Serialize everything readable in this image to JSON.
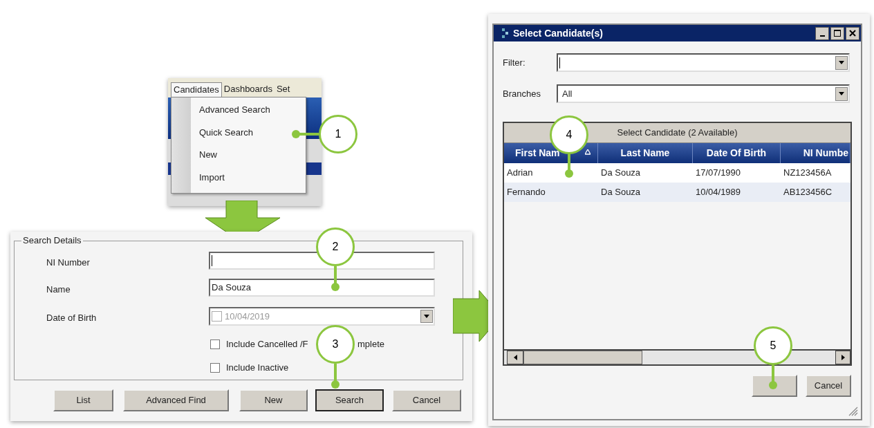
{
  "menu": {
    "tabs": [
      {
        "label": "Candidates",
        "selected": true
      },
      {
        "label": "Dashboards",
        "selected": false
      },
      {
        "label": "Set",
        "selected": false
      }
    ],
    "items": [
      "Advanced Search",
      "Quick Search",
      "New",
      "Import"
    ]
  },
  "search_details": {
    "legend": "Search Details",
    "fields": [
      {
        "kind": "text",
        "label": "NI Number"
      },
      {
        "kind": "text",
        "label": "Name",
        "value": "Da Souza"
      },
      {
        "kind": "date",
        "label": "Date of Birth",
        "value": "10/04/2019",
        "checked": false
      }
    ],
    "checkboxes": [
      {
        "label_parts": [
          "Include Cancelled /F",
          "mplete"
        ],
        "checked": false
      },
      {
        "label_parts": [
          "Include Inactive"
        ],
        "checked": false
      }
    ],
    "buttons": [
      {
        "label": "List",
        "default": false
      },
      {
        "label": "Advanced Find",
        "default": false
      },
      {
        "label": "New",
        "default": false
      },
      {
        "label": "Search",
        "default": true
      },
      {
        "label": "Cancel",
        "default": false
      }
    ]
  },
  "dialog": {
    "title": "Select Candidate(s)",
    "filter": {
      "label": "Filter:"
    },
    "branches": {
      "label": "Branches",
      "value": "All"
    },
    "grid": {
      "group_header": "Select Candidate (2 Available)",
      "columns": [
        {
          "label": "First Nam",
          "sorted": true
        },
        {
          "label": "Last Name",
          "sorted": false
        },
        {
          "label": "Date Of Birth",
          "sorted": false
        },
        {
          "label": "NI Numbe",
          "sorted": false
        }
      ],
      "rows": [
        [
          "Adrian",
          "Da Souza",
          "17/07/1990",
          "NZ123456A"
        ],
        [
          "Fernando",
          "Da Souza",
          "10/04/1989",
          "AB123456C"
        ]
      ]
    },
    "buttons": [
      {
        "kind": "covered"
      },
      {
        "kind": "text",
        "label": "Cancel"
      }
    ]
  },
  "callouts": [
    "1",
    "2",
    "3",
    "4",
    "5"
  ]
}
